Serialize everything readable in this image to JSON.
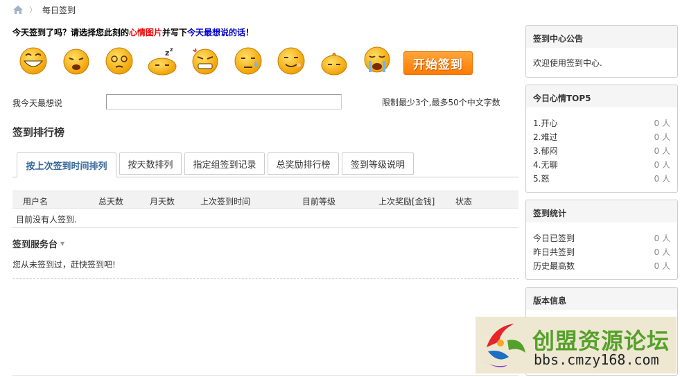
{
  "breadcrumb": {
    "current": "每日签到"
  },
  "prompt": {
    "part1": "今天签到了吗？请选择您此刻的",
    "part2": "心情图片",
    "part3": "并写下",
    "part4": "今天最想说的话",
    "part5": "！"
  },
  "moods": [
    "happy-face-icon",
    "sad-face-icon",
    "dizzy-face-icon",
    "sleepy-face-icon",
    "angry-face-icon",
    "sweat-face-icon",
    "sick-face-icon",
    "calm-face-icon",
    "crying-face-icon"
  ],
  "start_button": "开始签到",
  "say": {
    "label": "我今天最想说",
    "value": "",
    "hint": "限制最少3个,最多50个中文字数"
  },
  "ranking": {
    "title": "签到排行榜",
    "tabs": [
      "按上次签到时间排列",
      "按天数排列",
      "指定组签到记录",
      "总奖励排行榜",
      "签到等级说明"
    ],
    "columns": [
      "用户名",
      "总天数",
      "月天数",
      "上次签到时间",
      "目前等级",
      "上次奖励[金钱]",
      "状态"
    ],
    "empty": "目前没有人签到."
  },
  "service": {
    "title": "签到服务台",
    "message": "您从未签到过，赶快签到吧!"
  },
  "sidebar": {
    "notice": {
      "title": "签到中心公告",
      "text": "欢迎使用签到中心."
    },
    "mood_top": {
      "title": "今日心情TOP5",
      "items": [
        {
          "name": "1.开心",
          "count": "0 人"
        },
        {
          "name": "2.难过",
          "count": "0 人"
        },
        {
          "name": "3.郁闷",
          "count": "0 人"
        },
        {
          "name": "4.无聊",
          "count": "0 人"
        },
        {
          "name": "5.怒",
          "count": "0 人"
        }
      ]
    },
    "stats": {
      "title": "签到统计",
      "items": [
        {
          "name": "今日已签到",
          "count": "0 人"
        },
        {
          "name": "昨日共签到",
          "count": "0 人"
        },
        {
          "name": "历史最高数",
          "count": "0 人"
        }
      ]
    },
    "version": {
      "title": "版本信息"
    }
  },
  "watermark": {
    "name": "创盟资源论坛",
    "url": "bbs.cmzy168.com"
  },
  "colors": {
    "accent_orange": "#ff8a00",
    "tab_active": "#336699",
    "prompt_red": "#ee0000",
    "prompt_blue": "#0000cc",
    "watermark_green": "#55a02a"
  }
}
